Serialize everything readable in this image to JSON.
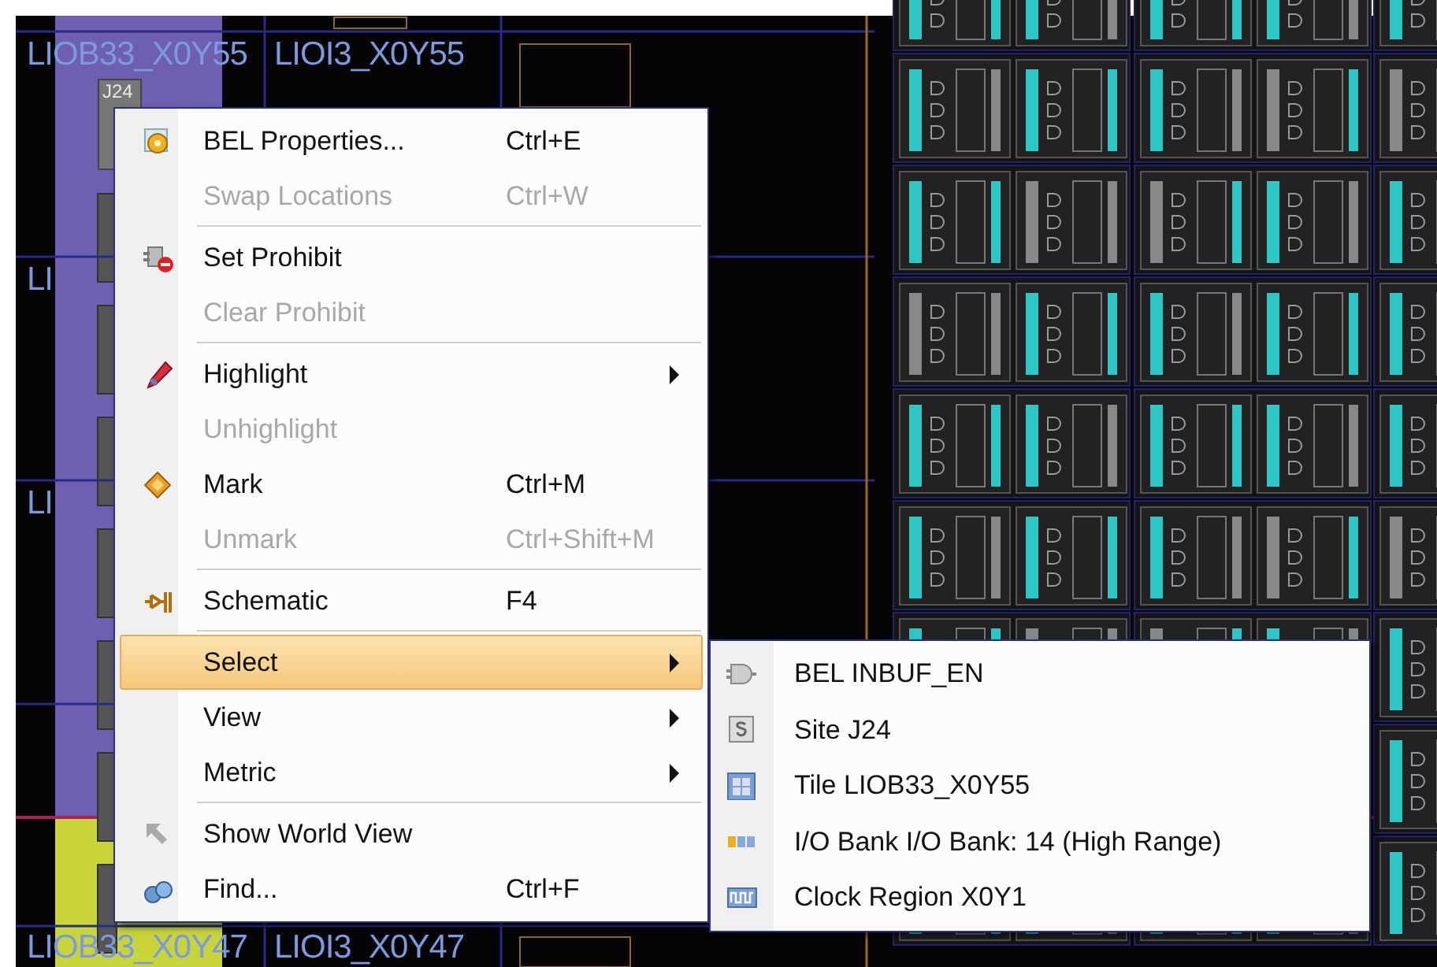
{
  "canvas": {
    "tile_labels": [
      "LIOB33_X0Y55",
      "LIOI3_X0Y55",
      "LI",
      "LI",
      "LIOB33_X0Y47",
      "LIOI3_X0Y47"
    ],
    "site_label": "J24"
  },
  "context_menu": {
    "items": [
      {
        "kind": "item",
        "label": "BEL Properties...",
        "shortcut": "Ctrl+E",
        "disabled": false,
        "submenu": false,
        "selected": false
      },
      {
        "kind": "item",
        "label": "Swap Locations",
        "shortcut": "Ctrl+W",
        "disabled": true,
        "submenu": false,
        "selected": false
      },
      {
        "kind": "separator"
      },
      {
        "kind": "item",
        "label": "Set Prohibit",
        "disabled": false,
        "submenu": false,
        "selected": false
      },
      {
        "kind": "item",
        "label": "Clear Prohibit",
        "disabled": true,
        "submenu": false,
        "selected": false
      },
      {
        "kind": "separator"
      },
      {
        "kind": "item",
        "label": "Highlight",
        "disabled": false,
        "submenu": true,
        "selected": false
      },
      {
        "kind": "item",
        "label": "Unhighlight",
        "disabled": true,
        "submenu": false,
        "selected": false
      },
      {
        "kind": "item",
        "label": "Mark",
        "shortcut": "Ctrl+M",
        "disabled": false,
        "submenu": false,
        "selected": false
      },
      {
        "kind": "item",
        "label": "Unmark",
        "shortcut": "Ctrl+Shift+M",
        "disabled": true,
        "submenu": false,
        "selected": false
      },
      {
        "kind": "separator"
      },
      {
        "kind": "item",
        "label": "Schematic",
        "shortcut": "F4",
        "disabled": false,
        "submenu": false,
        "selected": false
      },
      {
        "kind": "separator"
      },
      {
        "kind": "item",
        "label": "Select",
        "disabled": false,
        "submenu": true,
        "selected": true
      },
      {
        "kind": "item",
        "label": "View",
        "disabled": false,
        "submenu": true,
        "selected": false
      },
      {
        "kind": "item",
        "label": "Metric",
        "disabled": false,
        "submenu": true,
        "selected": false
      },
      {
        "kind": "separator"
      },
      {
        "kind": "item",
        "label": "Show World View",
        "disabled": false,
        "submenu": false,
        "selected": false
      },
      {
        "kind": "item",
        "label": "Find...",
        "shortcut": "Ctrl+F",
        "disabled": false,
        "submenu": false,
        "selected": false
      }
    ]
  },
  "submenu": {
    "items": [
      {
        "label": "BEL INBUF_EN"
      },
      {
        "label": "Site J24"
      },
      {
        "label": "Tile LIOB33_X0Y55"
      },
      {
        "label": "I/O Bank I/O Bank: 14 (High Range)"
      },
      {
        "label": "Clock Region X0Y1"
      }
    ]
  }
}
